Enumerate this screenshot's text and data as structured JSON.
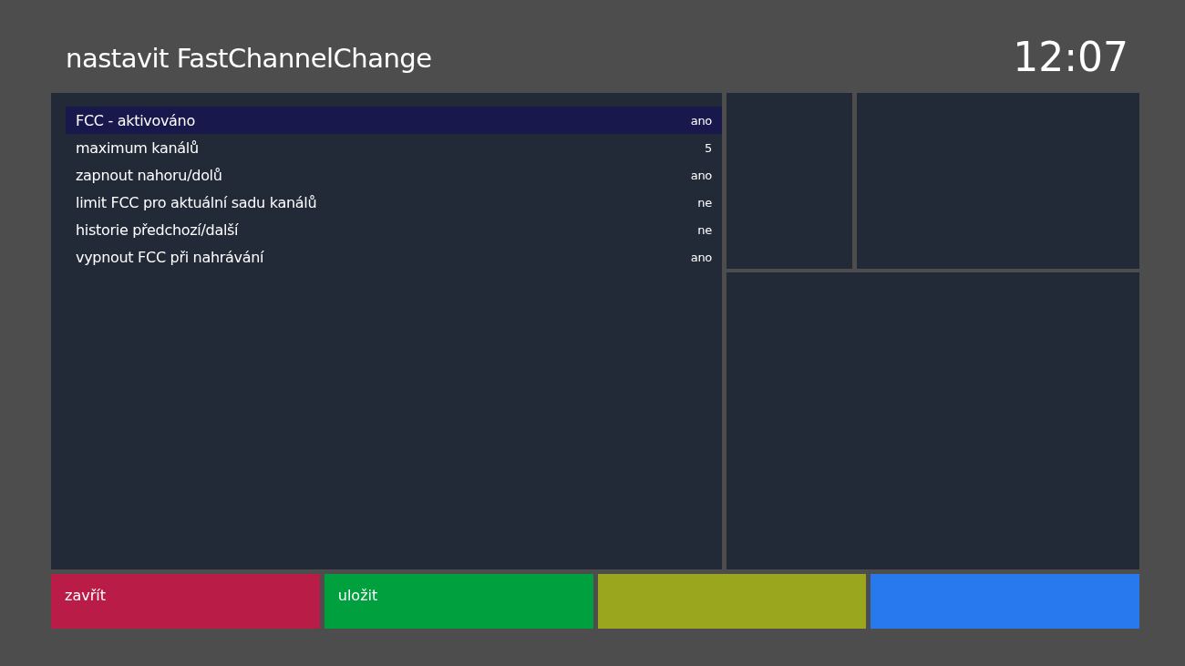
{
  "header": {
    "title": "nastavit FastChannelChange",
    "clock": "12:07"
  },
  "settings": [
    {
      "label": "FCC - aktivováno",
      "value": "ano",
      "selected": true
    },
    {
      "label": "maximum kanálů",
      "value": "5",
      "selected": false
    },
    {
      "label": "zapnout nahoru/dolů",
      "value": "ano",
      "selected": false
    },
    {
      "label": "limit FCC pro aktuální sadu kanálů",
      "value": "ne",
      "selected": false
    },
    {
      "label": "historie předchozí/další",
      "value": "ne",
      "selected": false
    },
    {
      "label": "vypnout FCC při nahrávání",
      "value": "ano",
      "selected": false
    }
  ],
  "color_buttons": [
    {
      "label": "zavřít",
      "color": "#b91c47"
    },
    {
      "label": "uložit",
      "color": "#00a03e"
    },
    {
      "color": "#9aa61e"
    },
    {
      "color": "#2878ee"
    }
  ]
}
